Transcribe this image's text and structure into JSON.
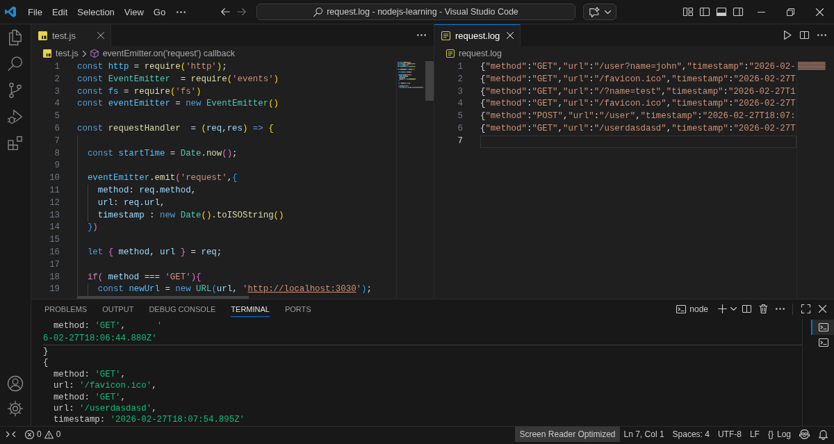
{
  "title_bar": {
    "menu": [
      "File",
      "Edit",
      "Selection",
      "View",
      "Go"
    ],
    "navigation": {
      "back_disabled": false,
      "forward_disabled": true
    },
    "command_center": "request.log - nodejs-learning - Visual Studio Code",
    "layout_toggles": [
      {
        "kind": "primary_sidebar",
        "on": false
      },
      {
        "kind": "panel",
        "on": true
      },
      {
        "kind": "secondary_sidebar",
        "on": false
      }
    ]
  },
  "activity_bar": {
    "items": [
      {
        "kind": "explorer",
        "selected": false
      },
      {
        "kind": "search",
        "selected": false
      },
      {
        "kind": "source_control",
        "selected": false
      },
      {
        "kind": "run_debug",
        "selected": false
      },
      {
        "kind": "extensions",
        "selected": false
      }
    ],
    "bottom": [
      {
        "kind": "accounts"
      },
      {
        "kind": "manage"
      }
    ]
  },
  "editor_groups": [
    {
      "focused": false,
      "tabs": [
        {
          "label": "test.js",
          "kind": "js",
          "selected": true
        }
      ],
      "actions": [
        {
          "kind": "more"
        }
      ],
      "breadcrumbs": [
        {
          "kind": "file_js",
          "text": "test.js"
        },
        {
          "kind": "symbol",
          "text": "eventEmitter.on('request') callback"
        }
      ],
      "scrollbars": {
        "vertical": true,
        "horizontal": true
      },
      "lines": [
        {
          "number": "1",
          "current": false,
          "tokens": [
            {
              "text": "const ",
              "kind": "keyword"
            },
            {
              "text": "http",
              "kind": "constant"
            },
            {
              "text": " = ",
              "kind": "plain"
            },
            {
              "text": "require",
              "kind": "function"
            },
            {
              "text": "(",
              "kind": "bracket1"
            },
            {
              "text": "'http'",
              "kind": "string"
            },
            {
              "text": ")",
              "kind": "bracket1"
            },
            {
              "text": ";",
              "kind": "plain"
            }
          ]
        },
        {
          "number": "2",
          "current": false,
          "tokens": [
            {
              "text": "const ",
              "kind": "keyword"
            },
            {
              "text": "EventEmitter",
              "kind": "class"
            },
            {
              "text": "  = ",
              "kind": "plain"
            },
            {
              "text": "require",
              "kind": "function"
            },
            {
              "text": "(",
              "kind": "bracket1"
            },
            {
              "text": "'events'",
              "kind": "string"
            },
            {
              "text": ")",
              "kind": "bracket1"
            }
          ]
        },
        {
          "number": "3",
          "current": false,
          "tokens": [
            {
              "text": "const ",
              "kind": "keyword"
            },
            {
              "text": "fs",
              "kind": "constant"
            },
            {
              "text": " = ",
              "kind": "plain"
            },
            {
              "text": "require",
              "kind": "function"
            },
            {
              "text": "(",
              "kind": "bracket1"
            },
            {
              "text": "'fs'",
              "kind": "string"
            },
            {
              "text": ")",
              "kind": "bracket1"
            }
          ]
        },
        {
          "number": "4",
          "current": false,
          "tokens": [
            {
              "text": "const ",
              "kind": "keyword"
            },
            {
              "text": "eventEmitter",
              "kind": "constant"
            },
            {
              "text": " = ",
              "kind": "plain"
            },
            {
              "text": "new ",
              "kind": "keyword"
            },
            {
              "text": "EventEmitter",
              "kind": "class"
            },
            {
              "text": "()",
              "kind": "bracket1"
            }
          ]
        },
        {
          "number": "5",
          "current": false
        },
        {
          "number": "6",
          "current": false,
          "tokens": [
            {
              "text": "const ",
              "kind": "keyword"
            },
            {
              "text": "requestHandler",
              "kind": "function"
            },
            {
              "text": "  = ",
              "kind": "plain"
            },
            {
              "text": "(",
              "kind": "bracket1"
            },
            {
              "text": "req",
              "kind": "variable"
            },
            {
              "text": ",",
              "kind": "plain"
            },
            {
              "text": "res",
              "kind": "variable"
            },
            {
              "text": ")",
              "kind": "bracket1"
            },
            {
              "text": " => ",
              "kind": "keyword"
            },
            {
              "text": "{",
              "kind": "bracket1"
            }
          ]
        },
        {
          "number": "7",
          "current": false
        },
        {
          "number": "8",
          "current": false,
          "tokens": [
            {
              "text": "  const ",
              "kind": "keyword"
            },
            {
              "text": "startTime",
              "kind": "constant"
            },
            {
              "text": " = ",
              "kind": "plain"
            },
            {
              "text": "Date",
              "kind": "class"
            },
            {
              "text": ".",
              "kind": "plain"
            },
            {
              "text": "now",
              "kind": "function"
            },
            {
              "text": "()",
              "kind": "bracket2"
            },
            {
              "text": ";",
              "kind": "plain"
            }
          ]
        },
        {
          "number": "9",
          "current": false
        },
        {
          "number": "10",
          "current": false,
          "tokens": [
            {
              "text": "  eventEmitter",
              "kind": "constant"
            },
            {
              "text": ".",
              "kind": "plain"
            },
            {
              "text": "emit",
              "kind": "function"
            },
            {
              "text": "(",
              "kind": "bracket2"
            },
            {
              "text": "'request'",
              "kind": "string"
            },
            {
              "text": ",",
              "kind": "plain"
            },
            {
              "text": "{",
              "kind": "bracket3"
            }
          ]
        },
        {
          "number": "11",
          "current": false,
          "tokens": [
            {
              "text": "    method",
              "kind": "variable"
            },
            {
              "text": ": ",
              "kind": "plain"
            },
            {
              "text": "req",
              "kind": "variable"
            },
            {
              "text": ".",
              "kind": "plain"
            },
            {
              "text": "method",
              "kind": "variable"
            },
            {
              "text": ",",
              "kind": "plain"
            }
          ]
        },
        {
          "number": "12",
          "current": false,
          "tokens": [
            {
              "text": "    url",
              "kind": "variable"
            },
            {
              "text": ": ",
              "kind": "plain"
            },
            {
              "text": "req",
              "kind": "variable"
            },
            {
              "text": ".",
              "kind": "plain"
            },
            {
              "text": "url",
              "kind": "variable"
            },
            {
              "text": ",",
              "kind": "plain"
            }
          ]
        },
        {
          "number": "13",
          "current": false,
          "tokens": [
            {
              "text": "    timestamp",
              "kind": "variable"
            },
            {
              "text": " : ",
              "kind": "plain"
            },
            {
              "text": "new ",
              "kind": "keyword"
            },
            {
              "text": "Date",
              "kind": "class"
            },
            {
              "text": "()",
              "kind": "bracket1"
            },
            {
              "text": ".",
              "kind": "plain"
            },
            {
              "text": "toISOString",
              "kind": "function"
            },
            {
              "text": "()",
              "kind": "bracket1"
            }
          ]
        },
        {
          "number": "14",
          "current": false,
          "tokens": [
            {
              "text": "  }",
              "kind": "bracket3"
            },
            {
              "text": ")",
              "kind": "bracket2"
            }
          ]
        },
        {
          "number": "15",
          "current": false
        },
        {
          "number": "16",
          "current": false,
          "tokens": [
            {
              "text": "  let ",
              "kind": "keyword"
            },
            {
              "text": "{",
              "kind": "bracket2"
            },
            {
              "text": " method",
              "kind": "variable"
            },
            {
              "text": ", ",
              "kind": "plain"
            },
            {
              "text": "url ",
              "kind": "variable"
            },
            {
              "text": "}",
              "kind": "bracket2"
            },
            {
              "text": " = ",
              "kind": "plain"
            },
            {
              "text": "req",
              "kind": "variable"
            },
            {
              "text": ";",
              "kind": "plain"
            }
          ]
        },
        {
          "number": "17",
          "current": false
        },
        {
          "number": "18",
          "current": false,
          "tokens": [
            {
              "text": "  if",
              "kind": "control"
            },
            {
              "text": "(",
              "kind": "bracket2"
            },
            {
              "text": " method",
              "kind": "variable"
            },
            {
              "text": " === ",
              "kind": "plain"
            },
            {
              "text": "'GET'",
              "kind": "string"
            },
            {
              "text": ")",
              "kind": "bracket2"
            },
            {
              "text": "{",
              "kind": "bracket2"
            }
          ]
        },
        {
          "number": "19",
          "current": false,
          "tokens": [
            {
              "text": "    const ",
              "kind": "keyword"
            },
            {
              "text": "newUrl",
              "kind": "constant"
            },
            {
              "text": " = ",
              "kind": "plain"
            },
            {
              "text": "new ",
              "kind": "keyword"
            },
            {
              "text": "URL",
              "kind": "class"
            },
            {
              "text": "(",
              "kind": "bracket3"
            },
            {
              "text": "url",
              "kind": "variable"
            },
            {
              "text": ", ",
              "kind": "plain"
            },
            {
              "text": "'",
              "kind": "string"
            },
            {
              "text": "http://localhost:3030",
              "kind": "link"
            },
            {
              "text": "'",
              "kind": "string"
            },
            {
              "text": ")",
              "kind": "bracket3"
            },
            {
              "text": ";",
              "kind": "plain"
            }
          ]
        }
      ]
    },
    {
      "focused": true,
      "tabs": [
        {
          "label": "request.log",
          "kind": "log",
          "selected": true
        }
      ],
      "actions": [
        {
          "kind": "run"
        },
        {
          "kind": "split"
        },
        {
          "kind": "more"
        }
      ],
      "breadcrumbs": [
        {
          "kind": "file_log",
          "text": "request.log"
        }
      ],
      "lines": [
        {
          "number": "1",
          "current": false,
          "text": "{\"method\":\"GET\",\"url\":\"/user?name=john\",\"timestamp\":\"2026-02-"
        },
        {
          "number": "2",
          "current": false,
          "text": "{\"method\":\"GET\",\"url\":\"/favicon.ico\",\"timestamp\":\"2026-02-27T"
        },
        {
          "number": "3",
          "current": false,
          "text": "{\"method\":\"GET\",\"url\":\"/?name=test\",\"timestamp\":\"2026-02-27T1"
        },
        {
          "number": "4",
          "current": false,
          "text": "{\"method\":\"GET\",\"url\":\"/favicon.ico\",\"timestamp\":\"2026-02-27T"
        },
        {
          "number": "5",
          "current": false,
          "text": "{\"method\":\"POST\",\"url\":\"/user\",\"timestamp\":\"2026-02-27T18:07:"
        },
        {
          "number": "6",
          "current": false,
          "text": "{\"method\":\"GET\",\"url\":\"/userdasdasd\",\"timestamp\":\"2026-02-27T"
        },
        {
          "number": "7",
          "current": true
        }
      ]
    }
  ],
  "panel": {
    "tabs": [
      {
        "label": "PROBLEMS",
        "selected": false
      },
      {
        "label": "OUTPUT",
        "selected": false
      },
      {
        "label": "DEBUG CONSOLE",
        "selected": false
      },
      {
        "label": "TERMINAL",
        "selected": true
      },
      {
        "label": "PORTS",
        "selected": false
      }
    ],
    "terminal": {
      "name": "node",
      "pinned_lines": [
        {
          "tokens": [
            {
              "text": "  method: ",
              "kind": "plain"
            },
            {
              "text": "'GET'",
              "kind": "string"
            },
            {
              "text": ",      ",
              "kind": "plain"
            },
            {
              "text": "'",
              "kind": "string"
            }
          ]
        },
        {
          "tokens": [
            {
              "text": "6-02-27T18:06:44.880Z'",
              "kind": "string"
            }
          ]
        }
      ],
      "lines": [
        {
          "tokens": [
            {
              "text": "}",
              "kind": "plain"
            }
          ]
        },
        {
          "tokens": [
            {
              "text": "{",
              "kind": "plain"
            }
          ]
        },
        {
          "tokens": [
            {
              "text": "  method: ",
              "kind": "plain"
            },
            {
              "text": "'GET'",
              "kind": "string"
            },
            {
              "text": ",",
              "kind": "plain"
            }
          ]
        },
        {
          "tokens": [
            {
              "text": "  url: ",
              "kind": "plain"
            },
            {
              "text": "'/favicon.ico'",
              "kind": "string"
            },
            {
              "text": ",",
              "kind": "plain"
            }
          ]
        },
        {
          "tokens": [
            {
              "text": "  method: ",
              "kind": "plain"
            },
            {
              "text": "'GET'",
              "kind": "string"
            },
            {
              "text": ",",
              "kind": "plain"
            }
          ]
        },
        {
          "tokens": [
            {
              "text": "  url: ",
              "kind": "plain"
            },
            {
              "text": "'/userdasdasd'",
              "kind": "string"
            },
            {
              "text": ",",
              "kind": "plain"
            }
          ]
        },
        {
          "tokens": [
            {
              "text": "  timestamp: ",
              "kind": "plain"
            },
            {
              "text": "'2026-02-27T18:07:54.895Z'",
              "kind": "string"
            }
          ]
        }
      ],
      "list": [
        {
          "selected": true
        },
        {
          "selected": false
        }
      ]
    }
  },
  "status_bar": {
    "problems": {
      "errors": "0",
      "warnings": "0"
    },
    "items": [
      {
        "kind": "text",
        "text": "Screen Reader Optimized",
        "prominent": true
      },
      {
        "kind": "text",
        "text": "Ln 7, Col 1",
        "prominent": false
      },
      {
        "kind": "text",
        "text": "Spaces: 4",
        "prominent": false
      },
      {
        "kind": "text",
        "text": "UTF-8",
        "prominent": false
      },
      {
        "kind": "text",
        "text": "LF",
        "prominent": false
      },
      {
        "kind": "language",
        "icon": "{}",
        "text": "Log",
        "prominent": false
      },
      {
        "kind": "copilot",
        "prominent": false
      },
      {
        "kind": "notifications",
        "prominent": false
      }
    ]
  }
}
